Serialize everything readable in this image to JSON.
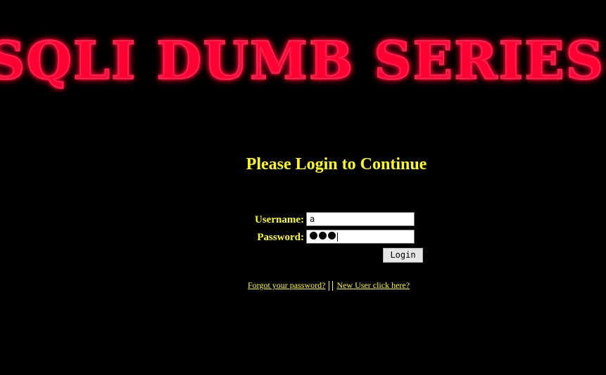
{
  "banner": {
    "text": "SQLI DUMB SERIES-"
  },
  "login": {
    "title": "Please Login to Continue",
    "username_label": "Username:",
    "password_label": "Password:",
    "username_value": "a",
    "password_masked_count": 3,
    "submit_label": "Login"
  },
  "links": {
    "forgot": "Forgot your password?",
    "new_user": "New User click here?"
  },
  "colors": {
    "background": "#000000",
    "text_accent": "#ffff00",
    "banner_glow": "#ff0033"
  }
}
